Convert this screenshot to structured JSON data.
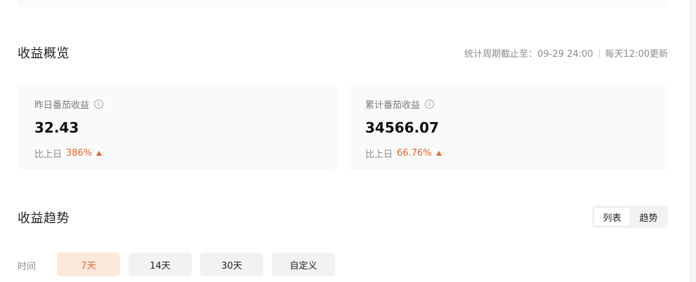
{
  "overview": {
    "title": "收益概览",
    "period_label": "统计周期截止至：09-29 24:00",
    "update_note": "每天12:00更新"
  },
  "cards": [
    {
      "label": "昨日番茄收益",
      "info_icon": "info-circle-icon",
      "value": "32.43",
      "compare_label": "比上日",
      "change": "386%",
      "trend_icon": "triangle-up-icon"
    },
    {
      "label": "累计番茄收益",
      "info_icon": "info-circle-icon",
      "value": "34566.07",
      "compare_label": "比上日",
      "change": "66.76%",
      "trend_icon": "triangle-up-icon"
    }
  ],
  "trend": {
    "title": "收益趋势",
    "view_options": [
      "列表",
      "趋势"
    ],
    "view_selected": "列表",
    "time_label": "时间",
    "ranges": [
      "7天",
      "14天",
      "30天",
      "自定义"
    ],
    "range_selected": "7天"
  },
  "colors": {
    "accent": "#e8642a",
    "accent_bg": "#fde8dc",
    "card_bg": "#fafafa",
    "button_bg": "#f2f2f2",
    "muted_text": "#8c8c8c"
  }
}
